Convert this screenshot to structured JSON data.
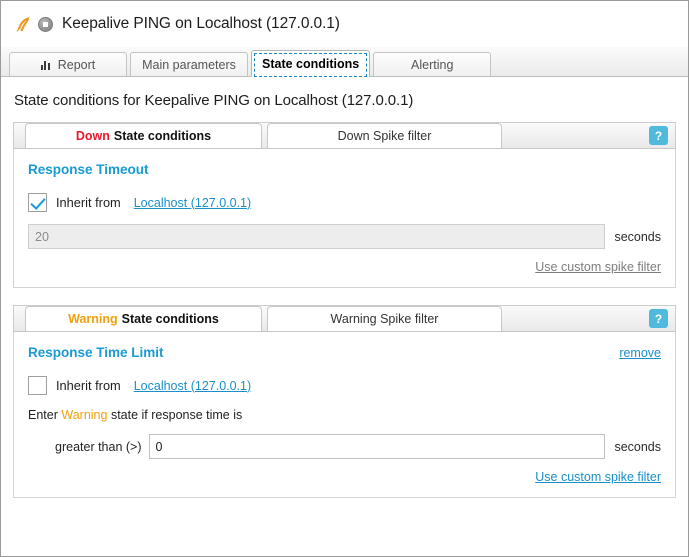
{
  "window": {
    "title": "Keepalive PING on Localhost (127.0.0.1)",
    "status_icon": "stopped-circle-icon",
    "brand_icon": "feather-icon"
  },
  "main_tabs": [
    {
      "label": "Report",
      "icon": "bar-chart-icon",
      "active": false
    },
    {
      "label": "Main parameters",
      "icon": "",
      "active": false
    },
    {
      "label": "State conditions",
      "icon": "",
      "active": true
    },
    {
      "label": "Alerting",
      "icon": "",
      "active": false
    }
  ],
  "page": {
    "title": "State conditions for Keepalive PING on Localhost (127.0.0.1)"
  },
  "colors": {
    "down": "#e8192c",
    "warning": "#f2a00c",
    "accent": "#1a9ad4",
    "link": "#1a8fc8",
    "help": "#4fb9de"
  },
  "sections": [
    {
      "id": "down",
      "tabs": {
        "state_word": "Down",
        "state_tab_rest": "State conditions",
        "spike_tab": "Down Spike filter"
      },
      "help_label": "?",
      "panel": {
        "title": "Response Timeout",
        "remove_label": "",
        "inherit_label": "Inherit from",
        "inherit_source": "Localhost (127.0.0.1)",
        "inherit_checked": true,
        "value": "20",
        "placeholder": "",
        "prefix_label": "",
        "unit": "seconds",
        "input_disabled": true,
        "spike_link": "Use custom spike filter",
        "spike_link_muted": true
      }
    },
    {
      "id": "warning",
      "tabs": {
        "state_word": "Warning",
        "state_tab_rest": "State conditions",
        "spike_tab": "Warning Spike filter"
      },
      "help_label": "?",
      "panel": {
        "title": "Response Time Limit",
        "remove_label": "remove",
        "inherit_label": "Inherit from",
        "inherit_source": "Localhost (127.0.0.1)",
        "inherit_checked": false,
        "enter_prefix": "Enter",
        "enter_state": "Warning",
        "enter_suffix": "state if response time is",
        "value": "0",
        "placeholder": "",
        "prefix_label": "greater than (>)",
        "unit": "seconds",
        "input_disabled": false,
        "spike_link": "Use custom spike filter",
        "spike_link_muted": false
      }
    }
  ]
}
